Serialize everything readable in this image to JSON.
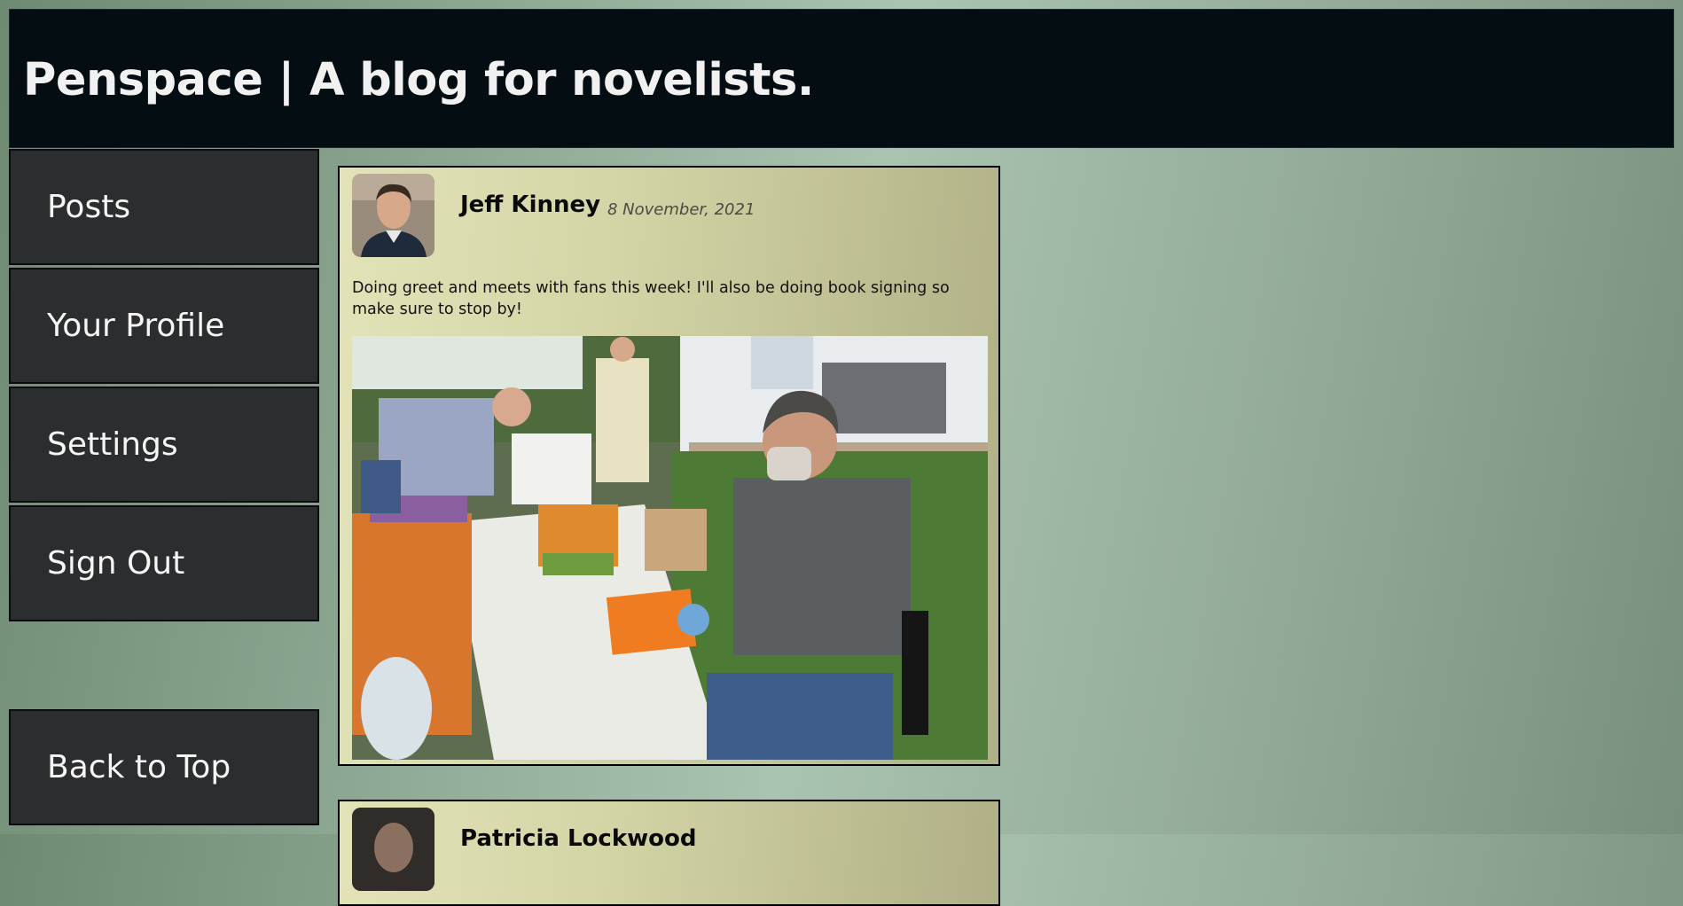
{
  "header": {
    "title": "Penspace | A blog for novelists."
  },
  "nav": {
    "posts": "Posts",
    "profile": "Your Profile",
    "settings": "Settings",
    "sign_out": "Sign Out",
    "back_to_top": "Back to Top"
  },
  "posts": [
    {
      "author": "Jeff Kinney",
      "date": "8 November, 2021",
      "text": "Doing greet and meets with fans this week! I'll also be doing book signing so make sure to stop by!"
    },
    {
      "author": "Patricia Lockwood"
    }
  ],
  "colors": {
    "header_bg": "#040d12",
    "nav_bg": "#2b2d2e",
    "post_bg": "#d3d5a6"
  }
}
